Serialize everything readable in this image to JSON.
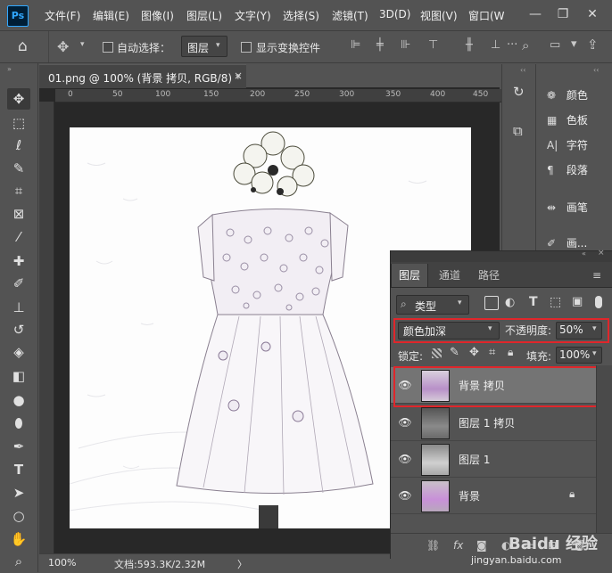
{
  "app": {
    "logo": "Ps"
  },
  "menu": [
    "文件(F)",
    "编辑(E)",
    "图像(I)",
    "图层(L)",
    "文字(Y)",
    "选择(S)",
    "滤镜(T)",
    "3D(D)",
    "视图(V)",
    "窗口(W"
  ],
  "window_controls": {
    "minimize": "—",
    "restore": "❐",
    "close": "✕"
  },
  "options": {
    "auto_select_label": "自动选择：",
    "auto_select_value": "图层",
    "show_transform_label": "显示变换控件"
  },
  "document": {
    "tab_title": "01.png @ 100% (背景 拷贝, RGB/8) *",
    "close": "×",
    "ruler_marks": [
      "0",
      "50",
      "100",
      "150",
      "200",
      "250",
      "300",
      "350",
      "400",
      "450"
    ],
    "zoom": "100%",
    "doc_info": "文档:593.3K/2.32M",
    "status_arrow": "〉"
  },
  "right_panels": [
    {
      "icon": "palette-icon",
      "label": "颜色"
    },
    {
      "icon": "swatches-icon",
      "label": "色板"
    },
    {
      "icon": "character-icon",
      "label": "字符"
    },
    {
      "icon": "paragraph-icon",
      "label": "段落"
    },
    {
      "icon": "brush-icon",
      "label": "画笔"
    },
    {
      "icon": "brush-settings-icon",
      "label": "画..."
    }
  ],
  "layers_panel": {
    "tabs": [
      "图层",
      "通道",
      "路径"
    ],
    "active_tab": "图层",
    "filter_label": "类型",
    "blend_mode": "颜色加深",
    "opacity_label": "不透明度:",
    "opacity_value": "50%",
    "lock_label": "锁定:",
    "fill_label": "填充:",
    "fill_value": "100%",
    "layers": [
      {
        "name": "背景 拷贝",
        "selected": true,
        "locked": false
      },
      {
        "name": "图层 1 拷贝",
        "selected": false,
        "locked": false
      },
      {
        "name": "图层 1",
        "selected": false,
        "locked": false
      },
      {
        "name": "背景",
        "selected": false,
        "locked": true
      }
    ],
    "footer_fx": "fx"
  },
  "watermark": {
    "text": "Baidu 经验",
    "url": "jingyan.baidu.com"
  },
  "colors": {
    "ui_bg": "#535353",
    "panel_dark": "#3c3c3c",
    "highlight_red": "#e0262b",
    "selected_layer": "#747474",
    "ps_blue": "#31a8ff"
  }
}
